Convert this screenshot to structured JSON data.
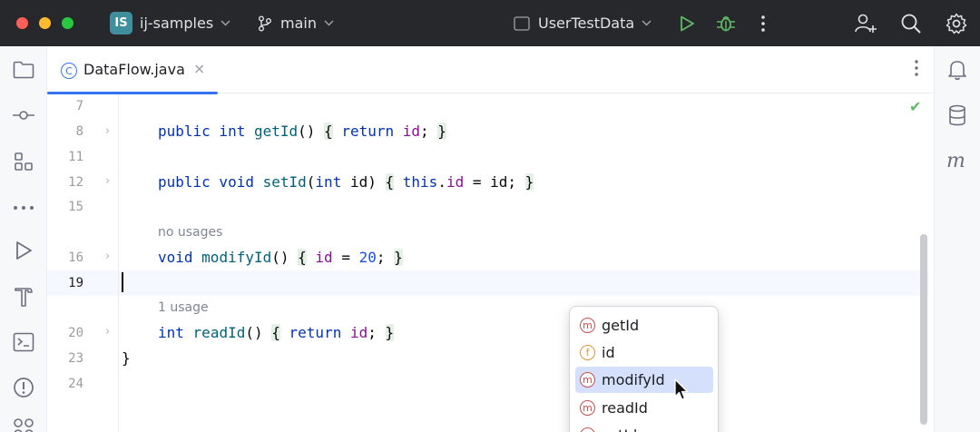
{
  "titlebar": {
    "project_badge": "IS",
    "project_name": "ij-samples",
    "branch": "main",
    "run_config": "UserTestData"
  },
  "tab": {
    "icon_letter": "C",
    "filename": "DataFlow.java",
    "close_glyph": "×"
  },
  "editor": {
    "line_numbers": [
      "7",
      "8",
      "11",
      "12",
      "15",
      "16",
      "19",
      "20",
      "23",
      "24"
    ],
    "hint_no_usages": "no usages",
    "hint_one_usage": "1 usage",
    "code": {
      "getId_kw": "public int",
      "getId_name": "getId",
      "getId_return": "return",
      "getId_field": "id",
      "setId_kw": "public void",
      "setId_name": "setId",
      "setId_param_type": "int",
      "setId_param": "id",
      "setId_this": "this",
      "setId_field": "id",
      "modify_kw": "void",
      "modify_name": "modifyId",
      "modify_field": "id",
      "modify_value": "20",
      "read_kw": "int",
      "read_name": "readId",
      "read_return": "return",
      "read_field": "id",
      "close_brace": "}"
    }
  },
  "completion": {
    "items": [
      {
        "kind": "m",
        "label": "getId"
      },
      {
        "kind": "f",
        "label": "id"
      },
      {
        "kind": "m",
        "label": "modifyId"
      },
      {
        "kind": "m",
        "label": "readId"
      },
      {
        "kind": "m",
        "label": "setId"
      }
    ],
    "selected": "modifyId"
  },
  "icons": {
    "left_strip": [
      "folder-icon",
      "commit-icon",
      "structure-icon",
      "more-icon",
      "run-icon",
      "build-icon",
      "terminal-icon",
      "problems-icon",
      "services-icon"
    ],
    "right_strip": [
      "notifications-icon",
      "database-icon",
      "maven-icon"
    ],
    "toolbar": [
      "run-icon",
      "debug-icon",
      "more-vertical-icon",
      "add-user-icon",
      "search-icon",
      "settings-icon"
    ]
  },
  "colors": {
    "titlebar_bg": "#27282c",
    "accent": "#3574f0",
    "keyword": "#0033b3",
    "field": "#871094",
    "run_green": "#5fb865"
  }
}
